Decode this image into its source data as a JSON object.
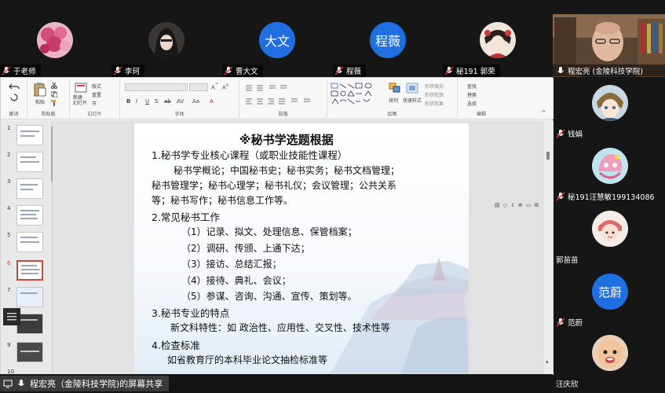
{
  "participants_top": [
    {
      "name": "于老师",
      "avatar_type": "photo-flowers"
    },
    {
      "name": "李珂",
      "avatar_type": "photo-woman"
    },
    {
      "name": "曹大文",
      "avatar_text": "大文"
    },
    {
      "name": "程薇",
      "avatar_text": "程薇"
    },
    {
      "name": "秘191 郭荣",
      "avatar_type": "photo-opera"
    }
  ],
  "participants_right": [
    {
      "name": "程宏亮 (金陵科技学院)",
      "avatar_type": "video-man"
    },
    {
      "name": "钱娟",
      "avatar_type": "anime-boy"
    },
    {
      "name": "秘191汪慧敏199134086",
      "avatar_type": "cartoon-pink"
    },
    {
      "name": "郭苗苗",
      "avatar_type": "drawing-girl"
    },
    {
      "name": "范蔚",
      "avatar_text": "范蔚"
    },
    {
      "name": "汪庆欣",
      "avatar_type": "baby"
    }
  ],
  "ribbon": {
    "groups": [
      "撤消",
      "剪贴板",
      "幻灯片",
      "字体",
      "段落",
      "绘图",
      "编辑"
    ],
    "buttons": {
      "paste": "粘贴",
      "new_slide": "新建\n幻灯片",
      "layout": "版式",
      "reset": "重置",
      "section": "节",
      "arrange": "排列",
      "quick_styles": "快速样式",
      "shape_fill": "形状填充",
      "shape_outline": "形状轮廓",
      "shape_effects": "形状效果",
      "find": "查找",
      "replace": "替换",
      "select": "选择"
    },
    "font_buttons": [
      "B",
      "I",
      "U",
      "S",
      "ab",
      "AV",
      "Aa",
      "A"
    ]
  },
  "slide_thumbs": [
    {
      "num": "1"
    },
    {
      "num": "2"
    },
    {
      "num": "3"
    },
    {
      "num": "4"
    },
    {
      "num": "5"
    },
    {
      "num": "6",
      "selected": true
    },
    {
      "num": "7"
    },
    {
      "num": "8"
    },
    {
      "num": "9"
    },
    {
      "num": "10"
    }
  ],
  "slide": {
    "title": "※秘书学选题根据",
    "h1": "1.秘书学专业核心课程（或职业技能性课程）",
    "p1a": "秘书学概论；中国秘书史；秘书实务；秘书文档管理；",
    "p1b": "秘书管理学；秘书心理学；秘书礼仪；会议管理；公共关系",
    "p1c": "等；秘书写作；秘书信息工作等。",
    "h2": "2.常见秘书工作",
    "items": [
      "（1）记录、拟文、处理信息、保管档案；",
      "（2）调研、传颁、上通下达；",
      "（3）接访、总结汇报；",
      "（4）接待、典礼、会议；",
      "（5）参谋、咨询、沟通、宣传、策划等。"
    ],
    "h3": "3.秘书专业的特点",
    "p3": "新文科特性：如 政治性、应用性、交叉性、技术性等",
    "h4": "4.检查标准",
    "p4": "如省教育厅的本科毕业论文抽检标准等"
  },
  "share_bar": {
    "text": "程宏亮（金陵科技学院)的屏幕共享"
  },
  "colors": {
    "accent_blue": "#1f6fe0",
    "selected_thumb": "#c94a3c",
    "background": "#1a1a1a"
  }
}
